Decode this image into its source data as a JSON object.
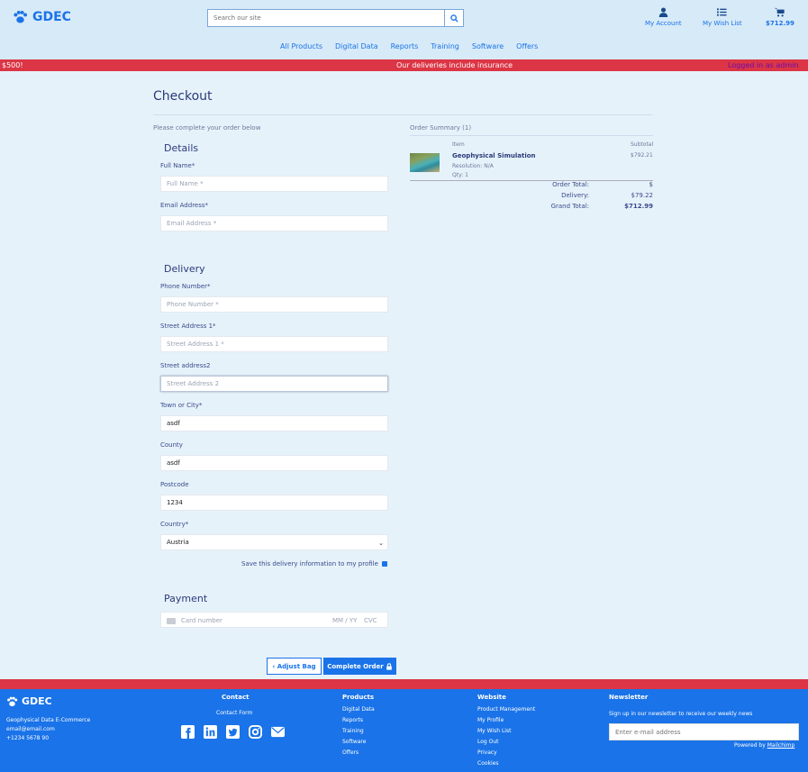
{
  "header": {
    "logo": "GDEC",
    "search_placeholder": "Search our site",
    "account_label": "My Account",
    "wishlist_label": "My Wish List",
    "cart_total": "$712.99",
    "nav": [
      "All Products",
      "Digital Data",
      "Reports",
      "Training",
      "Software",
      "Offers"
    ]
  },
  "banner": {
    "left": "$500!",
    "center": "Our deliveries include insurance",
    "right": "Logged in as admin"
  },
  "checkout": {
    "title": "Checkout",
    "instructions": "Please complete your order below",
    "details_title": "Details",
    "full_name_label": "Full Name*",
    "full_name_placeholder": "Full Name *",
    "email_label": "Email Address*",
    "email_placeholder": "Email Address *",
    "delivery_title": "Delivery",
    "phone_label": "Phone Number*",
    "phone_placeholder": "Phone Number *",
    "street1_label": "Street Address 1*",
    "street1_placeholder": "Street Address 1 *",
    "street2_label": "Street address2",
    "street2_placeholder": "Street Address 2",
    "town_label": "Town or City*",
    "town_value": "asdf",
    "county_label": "County",
    "county_value": "asdf",
    "postcode_label": "Postcode",
    "postcode_value": "1234",
    "country_label": "Country*",
    "country_value": "Austria",
    "save_label": "Save this delivery information to my profile",
    "payment_title": "Payment",
    "card_placeholder": "Card number",
    "expiry_placeholder": "MM / YY",
    "cvc_placeholder": "CVC",
    "adjust_bag": "Adjust Bag",
    "complete_order": "Complete Order"
  },
  "order_summary": {
    "title": "Order Summary (1)",
    "item_header": "Item",
    "subtotal_header": "Subtotal",
    "product_name": "Geophysical Simulation",
    "resolution": "Resolution: N/A",
    "qty": "Qty: 1",
    "product_price": "$792.21",
    "order_total_label": "Order Total:",
    "order_total_value": "$",
    "delivery_label": "Delivery:",
    "delivery_value": "$79.22",
    "grand_total_label": "Grand Total:",
    "grand_total_value": "$712.99"
  },
  "footer": {
    "logo": "GDEC",
    "company": "Geophysical Data E-Commerce",
    "email": "email@email.com",
    "phone": "+1234 5678 90",
    "contact_head": "Contact",
    "contact_form": "Contact Form",
    "products_head": "Products",
    "products": [
      "Digital Data",
      "Reports",
      "Training",
      "Software",
      "Offers"
    ],
    "website_head": "Website",
    "website": [
      "Product Management",
      "My Profile",
      "My Wish List",
      "Log Out",
      "Privacy",
      "Cookies"
    ],
    "newsletter_head": "Newsletter",
    "newsletter_text": "Sign up in our newsletter to receive our weekly news",
    "newsletter_placeholder": "Enter e-mail address",
    "powered_by": "Powered by",
    "mailchimp": "Mailchimp"
  },
  "colors": {
    "primary": "#1a73e8",
    "banner": "#dc3545",
    "page_bg": "#e6f2fa"
  }
}
